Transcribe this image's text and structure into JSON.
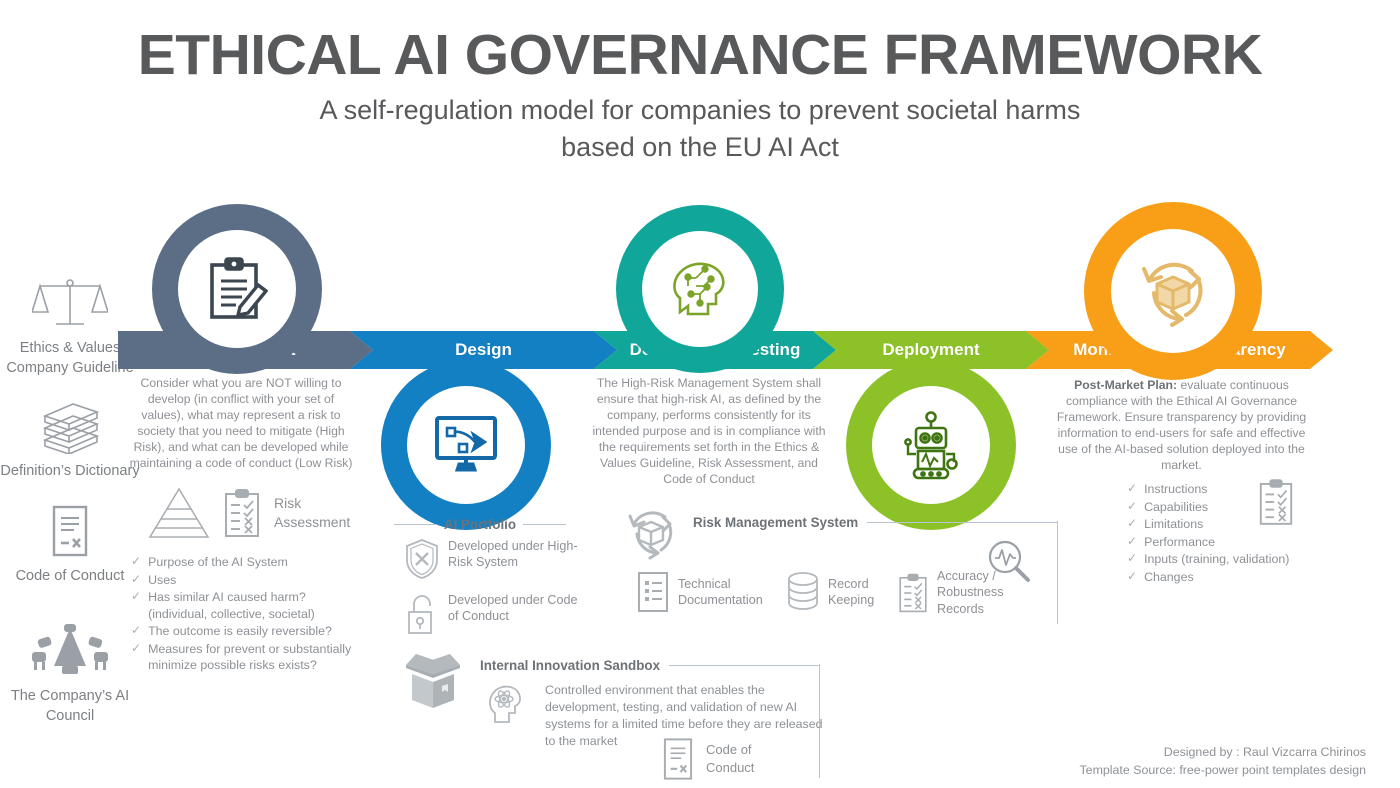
{
  "header": {
    "title": "ETHICAL AI GOVERNANCE FRAMEWORK",
    "subtitle_line1": "A self-regulation model for companies to prevent societal harms",
    "subtitle_line2": "based on the EU AI Act"
  },
  "sidebar": {
    "items": [
      {
        "icon": "scales-balance-icon",
        "label": "Ethics & Values Company Guideline"
      },
      {
        "icon": "stacked-books-icon",
        "label": "Definition’s Dictionary"
      },
      {
        "icon": "document-code-icon",
        "label": "Code of Conduct"
      },
      {
        "icon": "council-table-icon",
        "label": "The Company’s AI Council"
      }
    ]
  },
  "stages": [
    {
      "key": "assessment",
      "label": "Assessment",
      "color": "#5b6e85",
      "icon": "clipboard-pencil-icon"
    },
    {
      "key": "design",
      "label": "Design",
      "color": "#1380c4",
      "icon": "monitor-pen-tool-icon"
    },
    {
      "key": "development",
      "label": "Development/Testing",
      "color": "#10a699",
      "icon": "ai-head-circuit-icon"
    },
    {
      "key": "deployment",
      "label": "Deployment",
      "color": "#8cc227",
      "icon": "robot-icon"
    },
    {
      "key": "monitoring",
      "label": "Monitoring / Transparency",
      "color": "#f99f17",
      "icon": "package-recycle-icon"
    }
  ],
  "assessment": {
    "body": "Consider what you are NOT willing to develop (in conflict with your set of values), what may represent a risk to society that you need to mitigate (High Risk), and what can be developed while maintaining a code of conduct (Low Risk)",
    "risk_icon_pyramid": "pyramid-icon",
    "risk_icon_clipboard": "checklist-clipboard-icon",
    "risk_label_line1": "Risk",
    "risk_label_line2": "Assessment",
    "checklist": [
      "Purpose of the AI System",
      "Uses",
      "Has similar AI caused harm? (individual, collective, societal)",
      "The outcome is easily reversible?",
      "Measures for prevent or substantially minimize possible risks exists?"
    ]
  },
  "design": {
    "section_title": "AI Portfolio",
    "items": [
      {
        "icon": "shield-x-icon",
        "label": "Developed under High-Risk System"
      },
      {
        "icon": "open-padlock-icon",
        "label": "Developed under Code of Conduct"
      }
    ]
  },
  "development": {
    "body": "The High-Risk Management System shall ensure that high-risk AI, as defined by the company, performs consistently for its intended purpose and is in compliance with the requirements set forth in the Ethics & Values Guideline, Risk Assessment, and Code of Conduct",
    "rms": {
      "icon": "package-recycle-outline-icon",
      "title": "Risk Management System",
      "items": [
        {
          "icon": "technical-doc-icon",
          "label": "Technical Documentation"
        },
        {
          "icon": "database-icon",
          "label": "Record Keeping"
        },
        {
          "icon": "checklist-clipboard-icon",
          "label": "Accuracy / Robustness Records",
          "extra_icon": "magnifier-pulse-icon"
        }
      ]
    },
    "sandbox": {
      "icon": "open-box-icon",
      "title": "Internal Innovation Sandbox",
      "head_icon": "atom-head-icon",
      "body": "Controlled environment that enables the development, testing, and validation of new AI systems for a limited time before they are released to the market",
      "code": {
        "icon": "document-code-icon",
        "label_line1": "Code of",
        "label_line2": "Conduct"
      }
    }
  },
  "monitoring": {
    "body_strong": "Post-Market Plan:",
    "body": " evaluate continuous compliance with the Ethical AI Governance Framework. Ensure transparency by providing information to end-users for safe and effective use of the AI-based solution deployed into the market.",
    "clipboard_icon": "checklist-clipboard-icon",
    "checklist": [
      "Instructions",
      "Capabilities",
      "Limitations",
      "Performance",
      "Inputs (training, validation)",
      "Changes"
    ]
  },
  "credit": {
    "line1": "Designed by  : Raul Vizcarra Chirinos",
    "line2": "Template Source: free-power point templates design"
  }
}
